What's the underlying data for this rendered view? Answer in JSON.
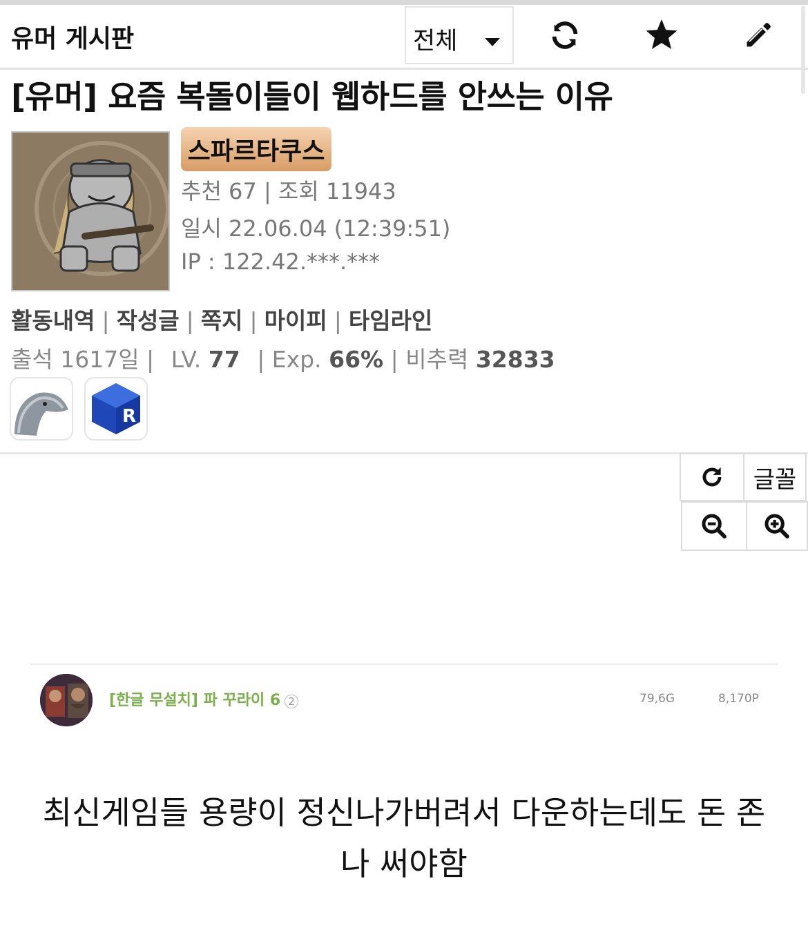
{
  "header": {
    "board_title": "유머 게시판",
    "category": "전체",
    "icons": [
      "refresh-icon",
      "star-icon",
      "pencil-icon"
    ]
  },
  "post": {
    "title": "[유머] 요즘 복돌이들이 웹하드를 안쓰는 이유",
    "author": "스파르타쿠스",
    "recommend_views": "추천 67 | 조회 11943",
    "datetime": "일시 22.06.04 (12:39:51)",
    "ip": "IP : 122.42.***.***"
  },
  "profile_links": [
    "활동내역",
    "작성글",
    "쪽지",
    "마이피",
    "타임라인"
  ],
  "stats": {
    "attendance": "출석 1617일 |",
    "level_label": "LV.",
    "level": "77",
    "exp_label": "| Exp.",
    "exp": "66%",
    "power_label": "| 비추력",
    "power": "32833"
  },
  "tools": {
    "font_label": "글꼴"
  },
  "embed": {
    "title": "[한글 무설치] 파 꾸라이 6",
    "count": "2",
    "size": "79,6G",
    "points": "8,170P"
  },
  "content": {
    "text": "최신게임들 용량이 정신나가버려서 다운하는데도 돈 존나 써야함"
  }
}
